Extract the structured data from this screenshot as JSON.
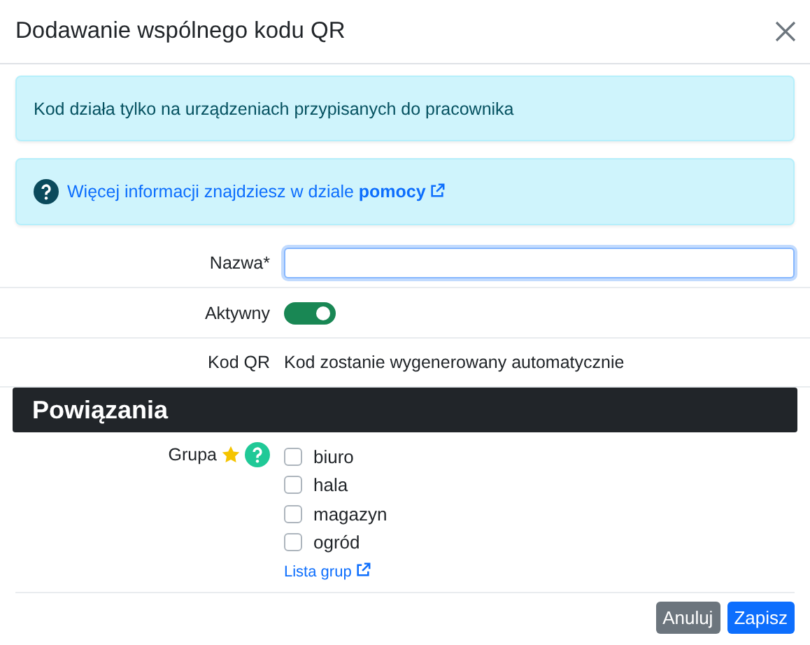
{
  "dialog": {
    "title": "Dodawanie wspólnego kodu QR"
  },
  "alerts": [
    {
      "kind": "text",
      "text": "Kod działa tylko na urządzeniach przypisanych do pracownika"
    },
    {
      "kind": "help_link",
      "text": "Więcej informacji znajdziesz w dziale **pomocy**"
    }
  ],
  "fields": [
    {
      "kind": "input",
      "label": "Nazwa*",
      "focused": true
    },
    {
      "kind": "toggle",
      "label": "Aktywny",
      "on": true
    },
    {
      "kind": "text",
      "label": "Kod QR",
      "value": "Kod zostanie wygenerowany automatycznie"
    }
  ],
  "section": {
    "title": "Powiązania"
  },
  "group": {
    "label": "Grupa",
    "starred": true,
    "options": [
      {
        "label": "biuro",
        "checked": false
      },
      {
        "label": "hala",
        "checked": false
      },
      {
        "label": "magazyn",
        "checked": false
      },
      {
        "label": "ogród",
        "checked": false
      }
    ],
    "link": "Lista grup"
  },
  "buttons": [
    {
      "kind": "secondary",
      "label": "Anuluj"
    },
    {
      "kind": "primary",
      "label": "Zapisz"
    }
  ]
}
